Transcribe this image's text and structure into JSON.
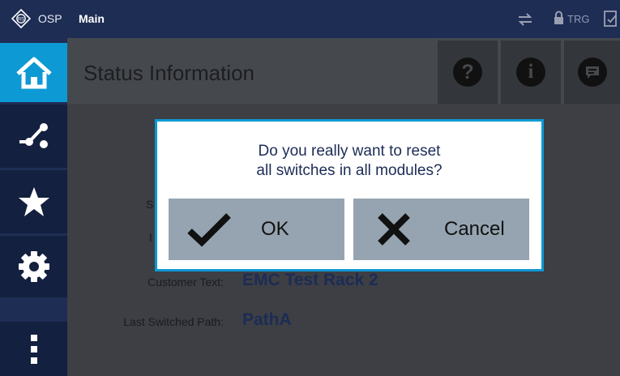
{
  "topbar": {
    "brand": "OSP",
    "title": "Main",
    "trg_label": "TRG",
    "icons": [
      "rs-logo-icon",
      "transfer-arrows-icon",
      "lock-icon",
      "sheet-check-icon"
    ]
  },
  "sidebar": {
    "items": [
      {
        "icon": "home-icon",
        "active": true
      },
      {
        "icon": "path-switch-icon",
        "active": false
      },
      {
        "icon": "star-icon",
        "active": false
      },
      {
        "icon": "gear-icon",
        "active": false
      },
      {
        "icon": "more-vertical-icon",
        "active": false
      }
    ]
  },
  "page": {
    "title": "Status Information",
    "header_buttons": [
      "help-icon",
      "info-icon",
      "message-icon"
    ]
  },
  "fields": {
    "partial_1": "S",
    "partial_2": "I",
    "customer_text_label": "Customer Text:",
    "customer_text_value": "EMC Test Rack 2",
    "last_switched_path_label": "Last Switched Path:",
    "last_switched_path_value": "PathA"
  },
  "dialog": {
    "line1": "Do you really want to reset",
    "line2": "all switches in all modules?",
    "ok_label": "OK",
    "cancel_label": "Cancel"
  },
  "colors": {
    "nav_bg": "#1e2d54",
    "accent": "#0d99d3",
    "button_gray": "#95a4b0",
    "value_text": "#1c2c55"
  }
}
